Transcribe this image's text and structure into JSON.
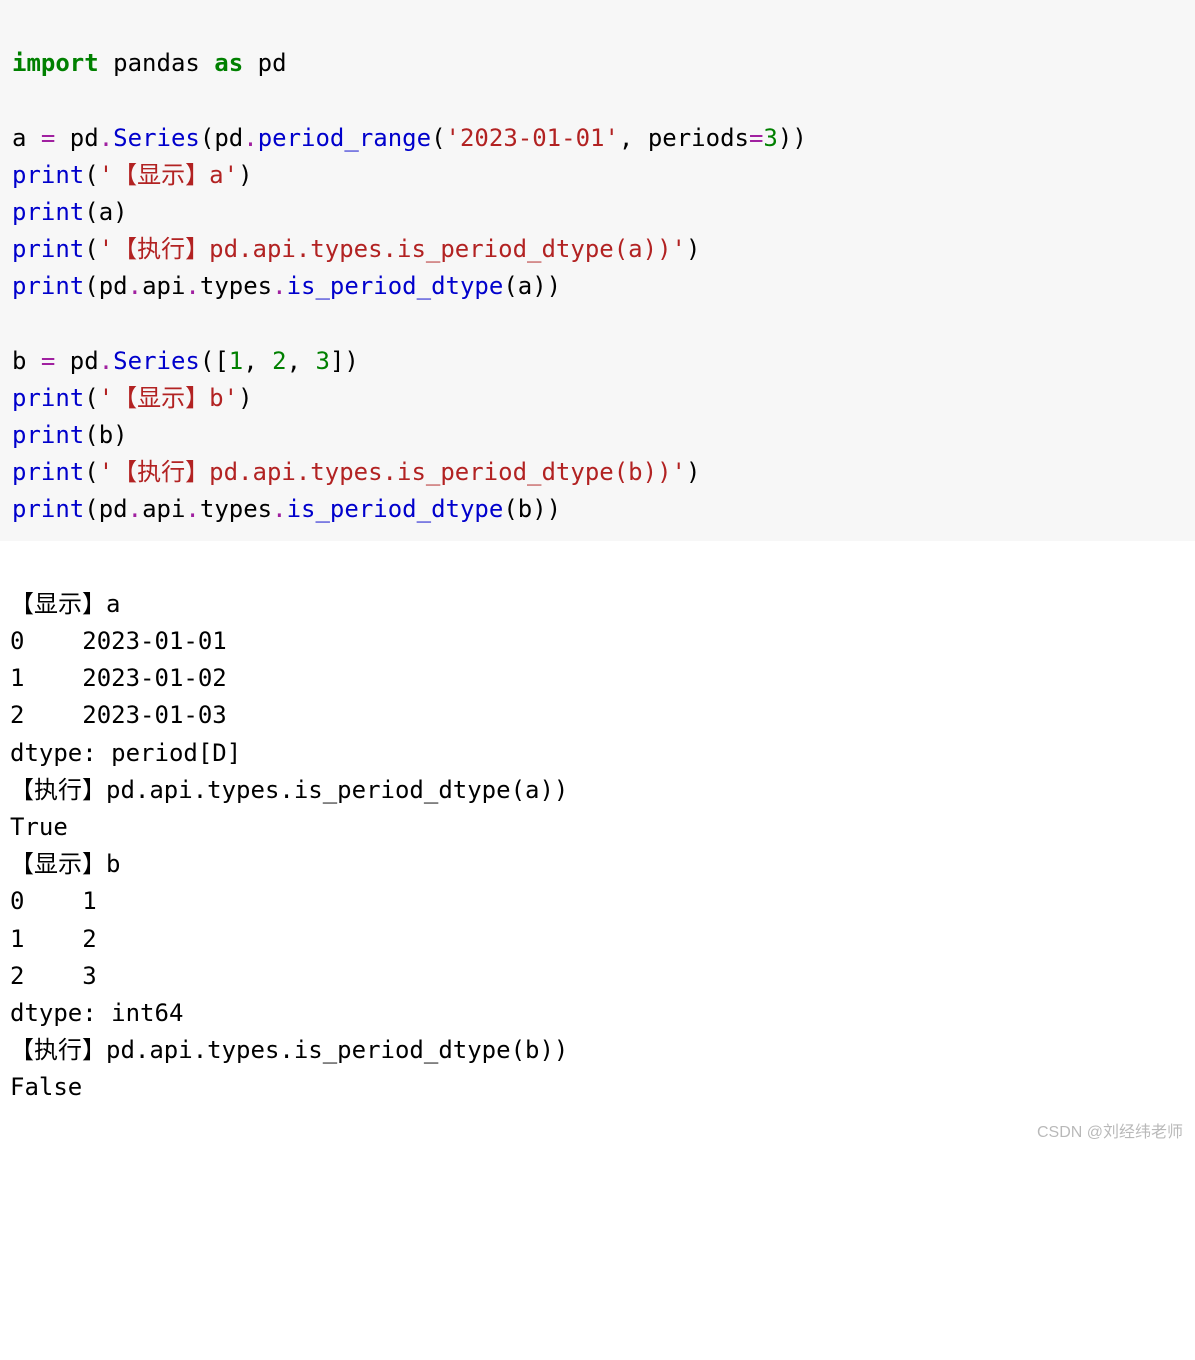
{
  "code": {
    "l1": {
      "kw1": "import",
      "t1": " pandas ",
      "kw2": "as",
      "t2": " pd"
    },
    "l3": {
      "t1": "a ",
      "op": "=",
      "t2": " pd",
      "d1": ".",
      "fn1": "Series",
      "p1": "(",
      "t3": "pd",
      "d2": ".",
      "fn2": "period_range",
      "p2": "(",
      "str": "'2023-01-01'",
      "t4": ", periods",
      "eq": "=",
      "num": "3",
      "p3": "))"
    },
    "l4": {
      "fn": "print",
      "p1": "(",
      "str": "'【显示】a'",
      "p2": ")"
    },
    "l5": {
      "fn": "print",
      "p1": "(",
      "t": "a",
      "p2": ")"
    },
    "l6": {
      "fn": "print",
      "p1": "(",
      "str": "'【执行】pd.api.types.is_period_dtype(a))'",
      "p2": ")"
    },
    "l7": {
      "fn": "print",
      "p1": "(",
      "t1": "pd",
      "d1": ".",
      "t2": "api",
      "d2": ".",
      "t3": "types",
      "d3": ".",
      "fn2": "is_period_dtype",
      "p2": "(",
      "t4": "a",
      "p3": "))"
    },
    "l9": {
      "t1": "b ",
      "op": "=",
      "t2": " pd",
      "d1": ".",
      "fn": "Series",
      "p1": "([",
      "n1": "1",
      "c1": ", ",
      "n2": "2",
      "c2": ", ",
      "n3": "3",
      "p2": "])"
    },
    "l10": {
      "fn": "print",
      "p1": "(",
      "str": "'【显示】b'",
      "p2": ")"
    },
    "l11": {
      "fn": "print",
      "p1": "(",
      "t": "b",
      "p2": ")"
    },
    "l12": {
      "fn": "print",
      "p1": "(",
      "str": "'【执行】pd.api.types.is_period_dtype(b))'",
      "p2": ")"
    },
    "l13": {
      "fn": "print",
      "p1": "(",
      "t1": "pd",
      "d1": ".",
      "t2": "api",
      "d2": ".",
      "t3": "types",
      "d3": ".",
      "fn2": "is_period_dtype",
      "p2": "(",
      "t4": "b",
      "p3": "))"
    }
  },
  "out": {
    "l1": "【显示】a",
    "l2": "0    2023-01-01",
    "l3": "1    2023-01-02",
    "l4": "2    2023-01-03",
    "l5": "dtype: period[D]",
    "l6": "【执行】pd.api.types.is_period_dtype(a))",
    "l7": "True",
    "l8": "【显示】b",
    "l9": "0    1",
    "l10": "1    2",
    "l11": "2    3",
    "l12": "dtype: int64",
    "l13": "【执行】pd.api.types.is_period_dtype(b))",
    "l14": "False"
  },
  "watermark": "CSDN @刘经纬老师"
}
